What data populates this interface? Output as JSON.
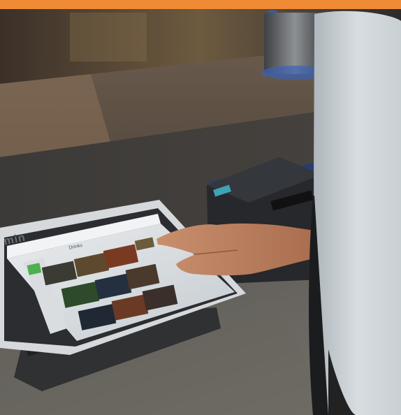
{
  "photo": {
    "brand_partial_text": "min",
    "screen_category_label": "Drinks",
    "accent_bar_color": "#ef8a35",
    "screen_accent_color": "#4caf50"
  }
}
